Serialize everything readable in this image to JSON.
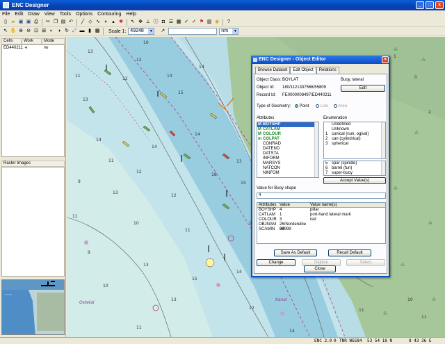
{
  "window": {
    "title": "ENC Designer"
  },
  "menu": [
    "File",
    "Edit",
    "Draw",
    "View",
    "Tools",
    "Options",
    "Contouring",
    "Help"
  ],
  "toolbar": {
    "scale_label": "Scale 1:",
    "scale_value": "49248",
    "unit_value": "nm"
  },
  "cells": {
    "headers": [
      "Cells",
      "Work",
      "Mode"
    ],
    "rows": [
      {
        "cell": "ED440211",
        "work": "◄",
        "mode": "rw"
      }
    ]
  },
  "raster": {
    "header": "Raster Images"
  },
  "status": {
    "enc": "ENC 2.0",
    "zero": "0",
    "coord_system": "TNR WGS84",
    "latitude": "53 54 18 N",
    "longitude": "8 43 36 E"
  },
  "dialog": {
    "title": "ENC Designer - Object Editor",
    "tabs": [
      "Browse Dataset",
      "Edit Object",
      "Relations"
    ],
    "object_class_label": "Object Class:",
    "object_class": "BOYLAT",
    "object_class_desc": "Buoy, lateral",
    "object_id_label": "Object Id:",
    "object_id": "180/1121337566/55809",
    "record_id_label": "Record Id:",
    "record_id": "FE0000008497/ED440211",
    "edit_button": "Edit",
    "geometry_label": "Type of Geometry:",
    "geometry_options": [
      "Point",
      "Line",
      "Area"
    ],
    "attributes_label": "Attributes",
    "attributes": [
      {
        "prefix": "M",
        "name": "BOYSHP",
        "green": true,
        "selected": true
      },
      {
        "prefix": "M",
        "name": "CATLAM",
        "green": true,
        "selected": false
      },
      {
        "prefix": "M",
        "name": "COLOUR",
        "green": true,
        "selected": false
      },
      {
        "prefix": "m",
        "name": "COLPAT",
        "green": true,
        "selected": false
      },
      {
        "prefix": "",
        "name": "CONRAD",
        "green": false,
        "selected": false
      },
      {
        "prefix": "",
        "name": "DATEND",
        "green": false,
        "selected": false
      },
      {
        "prefix": "",
        "name": "DATSTA",
        "green": false,
        "selected": false
      },
      {
        "prefix": "",
        "name": "INFORM",
        "green": false,
        "selected": false
      },
      {
        "prefix": "",
        "name": "MARSYS",
        "green": false,
        "selected": false
      },
      {
        "prefix": "",
        "name": "NATCON",
        "green": false,
        "selected": false
      },
      {
        "prefix": "",
        "name": "NINFOM",
        "green": false,
        "selected": false
      }
    ],
    "enumeration_label": "Enumeration",
    "enumeration": [
      {
        "n": "",
        "v": "Undefined"
      },
      {
        "n": "",
        "v": "Unknown"
      },
      {
        "n": "1",
        "v": "conical (nun, ogival)"
      },
      {
        "n": "2",
        "v": "can (cylindrical)"
      },
      {
        "n": "3",
        "v": "spherical"
      }
    ],
    "enumeration_more": [
      {
        "n": "5",
        "v": "spar (spindle)"
      },
      {
        "n": "6",
        "v": "barrel (tun)"
      },
      {
        "n": "7",
        "v": "super-buoy"
      }
    ],
    "accept_button": "Accept Value(s)",
    "value_label": "Value for Buoy shape",
    "value": "4",
    "table_headers": [
      "Attributes",
      "Value",
      "Value name(s)"
    ],
    "table_rows": [
      [
        "BOYSHP",
        "4",
        "pillar"
      ],
      [
        "CATLAM",
        "1",
        "port-hand lateral mark"
      ],
      [
        "COLOUR",
        "3",
        "red"
      ],
      [
        "OBJNAM",
        "26/Nordereibe 34",
        ""
      ],
      [
        "SCAMIN",
        "99999",
        ""
      ]
    ],
    "save_default_button": "Save As Default",
    "recall_default_button": "Recall Default",
    "change_button": "Change",
    "digitize_button": "Digitize",
    "select_button": "Select",
    "close_button": "Close"
  }
}
